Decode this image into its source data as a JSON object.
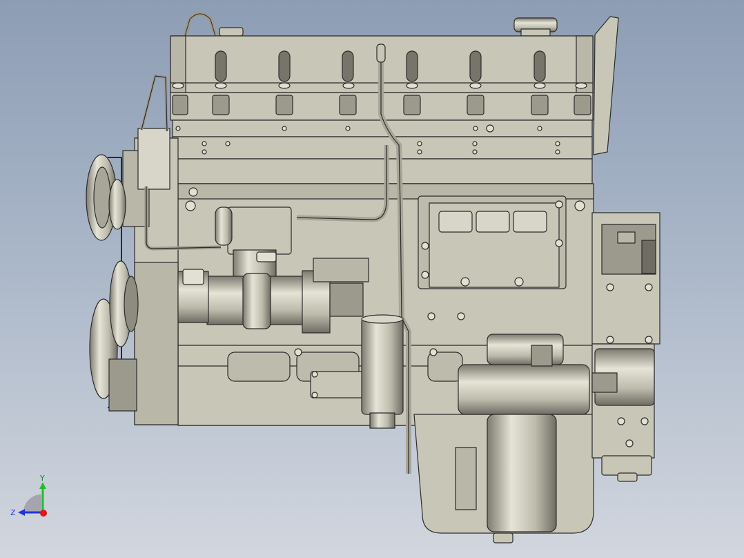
{
  "viewport": {
    "background_top": "#8d9db4",
    "background_bottom": "#d2d6de",
    "model": {
      "body_color": "#c8c6b6",
      "shadow_color": "#8e8c80",
      "edge_color": "#2b2b2b",
      "icon": "engine-block-model"
    }
  },
  "triad": {
    "y_label": "Y",
    "z_label": "Z",
    "y_color": "#1fbf2a",
    "z_color": "#2233dd",
    "x_color": "#e01818"
  }
}
